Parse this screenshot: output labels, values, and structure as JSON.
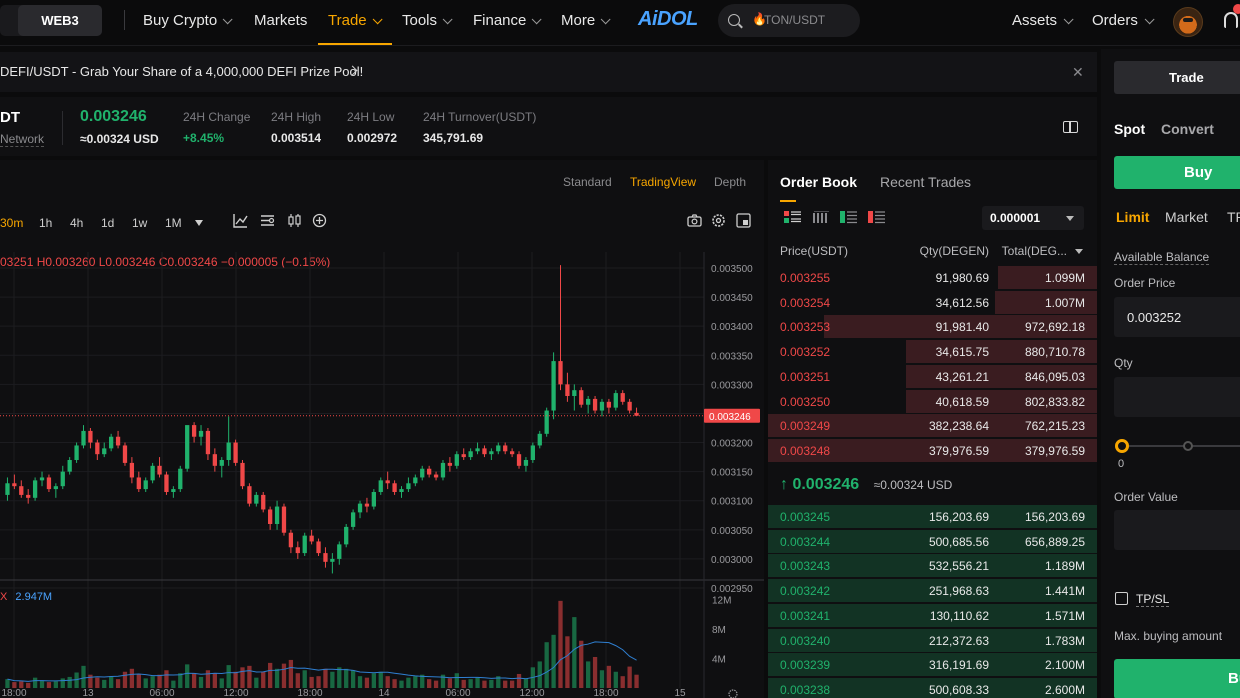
{
  "nav": {
    "segment_label": "WEB3",
    "items": [
      {
        "label": "Buy Crypto",
        "chevron": true
      },
      {
        "label": "Markets",
        "chevron": false
      },
      {
        "label": "Trade",
        "chevron": true,
        "active": true
      },
      {
        "label": "Tools",
        "chevron": true
      },
      {
        "label": "Finance",
        "chevron": true
      },
      {
        "label": "More",
        "chevron": true
      }
    ],
    "logo": "AiDOL",
    "search_placeholder": "TON/USDT",
    "assets_label": "Assets",
    "orders_label": "Orders"
  },
  "announcement": {
    "text": "DEFI/USDT - Grab Your Share of a 4,000,000 DEFI Prize Pool!"
  },
  "ticker": {
    "pair": "DT",
    "network_label": "Network",
    "last_price": "0.003246",
    "last_price_usd": "≈0.00324 USD",
    "stats": [
      {
        "label": "24H Change",
        "value": "+8.45%",
        "color": "#20b26c"
      },
      {
        "label": "24H High",
        "value": "0.003514",
        "color": "#e8e8e8"
      },
      {
        "label": "24H Low",
        "value": "0.002972",
        "color": "#e8e8e8"
      },
      {
        "label": "24H Turnover(USDT)",
        "value": "345,791.69",
        "color": "#e8e8e8"
      }
    ]
  },
  "chart": {
    "view_tabs": [
      "Standard",
      "TradingView",
      "Depth"
    ],
    "active_view": "TradingView",
    "intervals": [
      "30m",
      "1h",
      "4h",
      "1d",
      "1w",
      "1M"
    ],
    "active_interval": "30m",
    "ohlc_text": "03251  H0.003260  L0.003246  C0.003246  −0.000005 (−0.15%)",
    "volume_legend_prefix": "X",
    "volume_legend_value": "2.947M",
    "current_price_label": "0.003246"
  },
  "chart_data": {
    "type": "candlestick",
    "y_axis_ticks": [
      "0.003500",
      "0.003450",
      "0.003400",
      "0.003350",
      "0.003300",
      "0.003250",
      "0.003200",
      "0.003150",
      "0.003100",
      "0.003050",
      "0.003000",
      "0.002950"
    ],
    "ylim": [
      0.00295,
      0.0035
    ],
    "x_axis_ticks": [
      "18:00",
      "13",
      "06:00",
      "12:00",
      "18:00",
      "14",
      "06:00",
      "12:00",
      "18:00",
      "15"
    ],
    "volume_axis_ticks": [
      "12M",
      "8M",
      "4M"
    ],
    "candles": [
      [
        0.00311,
        0.00314,
        0.0031,
        0.00313
      ],
      [
        0.00313,
        0.003145,
        0.00312,
        0.003125
      ],
      [
        0.003125,
        0.003135,
        0.003105,
        0.00311
      ],
      [
        0.00311,
        0.00312,
        0.003095,
        0.003105
      ],
      [
        0.003105,
        0.00314,
        0.0031,
        0.003135
      ],
      [
        0.003135,
        0.00315,
        0.003125,
        0.00314
      ],
      [
        0.00314,
        0.003145,
        0.003115,
        0.00312
      ],
      [
        0.00312,
        0.00313,
        0.003105,
        0.003125
      ],
      [
        0.003125,
        0.00316,
        0.00312,
        0.00315
      ],
      [
        0.00315,
        0.003175,
        0.003145,
        0.00317
      ],
      [
        0.00317,
        0.0032,
        0.003165,
        0.003195
      ],
      [
        0.003195,
        0.00323,
        0.00319,
        0.00322
      ],
      [
        0.00322,
        0.003225,
        0.00319,
        0.0032
      ],
      [
        0.0032,
        0.003205,
        0.00317,
        0.00318
      ],
      [
        0.00318,
        0.0032,
        0.003175,
        0.00319
      ],
      [
        0.00319,
        0.003215,
        0.003185,
        0.00321
      ],
      [
        0.00321,
        0.00322,
        0.00319,
        0.003195
      ],
      [
        0.003195,
        0.0032,
        0.00316,
        0.003165
      ],
      [
        0.003165,
        0.003175,
        0.00313,
        0.00314
      ],
      [
        0.00314,
        0.00315,
        0.003115,
        0.00312
      ],
      [
        0.00312,
        0.00314,
        0.003115,
        0.003135
      ],
      [
        0.003135,
        0.003165,
        0.00313,
        0.00316
      ],
      [
        0.00316,
        0.003175,
        0.00314,
        0.003145
      ],
      [
        0.003145,
        0.00315,
        0.00311,
        0.003115
      ],
      [
        0.003115,
        0.003125,
        0.003105,
        0.00312
      ],
      [
        0.00312,
        0.00316,
        0.003115,
        0.003155
      ],
      [
        0.003155,
        0.003215,
        0.00315,
        0.00323
      ],
      [
        0.00323,
        0.003235,
        0.0032,
        0.00321
      ],
      [
        0.00321,
        0.00323,
        0.003195,
        0.00322
      ],
      [
        0.00322,
        0.003225,
        0.00317,
        0.00318
      ],
      [
        0.00318,
        0.00319,
        0.00315,
        0.00316
      ],
      [
        0.00316,
        0.003175,
        0.00314,
        0.00317
      ],
      [
        0.00317,
        0.003245,
        0.00316,
        0.0032
      ],
      [
        0.0032,
        0.003205,
        0.00316,
        0.003165
      ],
      [
        0.003165,
        0.00317,
        0.00312,
        0.003125
      ],
      [
        0.003125,
        0.00313,
        0.00309,
        0.003095
      ],
      [
        0.003095,
        0.003115,
        0.00309,
        0.00311
      ],
      [
        0.00311,
        0.003115,
        0.00308,
        0.003085
      ],
      [
        0.003085,
        0.00309,
        0.00305,
        0.00306
      ],
      [
        0.00306,
        0.0031,
        0.00305,
        0.00309
      ],
      [
        0.00309,
        0.003095,
        0.00304,
        0.003045
      ],
      [
        0.003045,
        0.00305,
        0.00301,
        0.00302
      ],
      [
        0.00302,
        0.00303,
        0.003,
        0.00301
      ],
      [
        0.00301,
        0.003045,
        0.003005,
        0.00304
      ],
      [
        0.00304,
        0.00305,
        0.003025,
        0.00303
      ],
      [
        0.00303,
        0.003035,
        0.003005,
        0.00301
      ],
      [
        0.00301,
        0.00302,
        0.002985,
        0.002995
      ],
      [
        0.002995,
        0.00301,
        0.002975,
        0.003
      ],
      [
        0.003,
        0.00303,
        0.00299,
        0.003025
      ],
      [
        0.003025,
        0.00306,
        0.00302,
        0.003055
      ],
      [
        0.003055,
        0.003085,
        0.00305,
        0.00308
      ],
      [
        0.00308,
        0.0031,
        0.00307,
        0.003095
      ],
      [
        0.003095,
        0.003105,
        0.00308,
        0.00309
      ],
      [
        0.00309,
        0.00312,
        0.003085,
        0.003115
      ],
      [
        0.003115,
        0.00314,
        0.00311,
        0.003135
      ],
      [
        0.003135,
        0.00315,
        0.00312,
        0.00313
      ],
      [
        0.00313,
        0.003135,
        0.00311,
        0.003115
      ],
      [
        0.003115,
        0.003125,
        0.003105,
        0.00312
      ],
      [
        0.00312,
        0.00314,
        0.003115,
        0.00313
      ],
      [
        0.00313,
        0.003145,
        0.003125,
        0.00314
      ],
      [
        0.00314,
        0.00316,
        0.003135,
        0.003155
      ],
      [
        0.003155,
        0.00316,
        0.00314,
        0.003145
      ],
      [
        0.003145,
        0.00315,
        0.003135,
        0.00314
      ],
      [
        0.00314,
        0.00317,
        0.003135,
        0.003165
      ],
      [
        0.003165,
        0.003175,
        0.00315,
        0.00316
      ],
      [
        0.00316,
        0.003185,
        0.003155,
        0.00318
      ],
      [
        0.00318,
        0.00319,
        0.00317,
        0.003175
      ],
      [
        0.003175,
        0.00319,
        0.00317,
        0.003185
      ],
      [
        0.003185,
        0.0032,
        0.00318,
        0.00319
      ],
      [
        0.00319,
        0.003195,
        0.003175,
        0.00318
      ],
      [
        0.00318,
        0.00319,
        0.00317,
        0.003185
      ],
      [
        0.003185,
        0.0032,
        0.00318,
        0.003195
      ],
      [
        0.003195,
        0.0032,
        0.00318,
        0.003185
      ],
      [
        0.003185,
        0.00319,
        0.003175,
        0.00318
      ],
      [
        0.00318,
        0.003185,
        0.003155,
        0.00316
      ],
      [
        0.00316,
        0.003175,
        0.00315,
        0.00317
      ],
      [
        0.00317,
        0.0032,
        0.003165,
        0.003195
      ],
      [
        0.003195,
        0.00322,
        0.00319,
        0.003215
      ],
      [
        0.003215,
        0.00326,
        0.00321,
        0.003255
      ],
      [
        0.003255,
        0.003355,
        0.00324,
        0.00334
      ],
      [
        0.00334,
        0.003505,
        0.00329,
        0.0033
      ],
      [
        0.0033,
        0.00332,
        0.00327,
        0.00328
      ],
      [
        0.00328,
        0.0033,
        0.003255,
        0.00329
      ],
      [
        0.00329,
        0.003295,
        0.00326,
        0.003265
      ],
      [
        0.003265,
        0.00328,
        0.00325,
        0.003275
      ],
      [
        0.003275,
        0.00328,
        0.00325,
        0.003255
      ],
      [
        0.003255,
        0.003275,
        0.003245,
        0.00327
      ],
      [
        0.00327,
        0.003275,
        0.00325,
        0.00326
      ],
      [
        0.00326,
        0.00329,
        0.003255,
        0.003285
      ],
      [
        0.003285,
        0.00329,
        0.003265,
        0.00327
      ],
      [
        0.00327,
        0.003275,
        0.00325,
        0.003255
      ],
      [
        0.003251,
        0.00326,
        0.003246,
        0.003246
      ]
    ],
    "volumes_m": [
      1.2,
      0.8,
      0.9,
      0.7,
      1.4,
      1.0,
      0.8,
      0.9,
      1.3,
      1.5,
      2.1,
      3.0,
      1.8,
      1.4,
      1.1,
      1.6,
      1.2,
      2.2,
      2.6,
      1.9,
      1.3,
      1.6,
      1.8,
      2.4,
      1.0,
      2.0,
      3.2,
      2.0,
      1.5,
      2.4,
      2.0,
      1.3,
      3.1,
      2.2,
      2.8,
      3.0,
      1.4,
      2.2,
      3.4,
      2.6,
      3.3,
      3.8,
      2.0,
      2.4,
      1.5,
      1.6,
      2.6,
      2.2,
      2.8,
      2.6,
      2.4,
      1.6,
      1.4,
      2.0,
      2.2,
      1.6,
      1.2,
      1.0,
      1.4,
      1.6,
      1.8,
      1.2,
      1.0,
      1.8,
      1.3,
      2.0,
      1.1,
      1.2,
      1.4,
      1.0,
      1.1,
      1.6,
      1.0,
      1.0,
      1.9,
      1.3,
      2.8,
      3.6,
      6.2,
      7.2,
      11.8,
      7.0,
      9.6,
      6.4,
      3.6,
      4.2,
      2.4,
      3.0,
      2.2,
      1.6,
      2.9,
      1.8
    ],
    "volume_ylim": [
      0,
      13
    ]
  },
  "orderbook": {
    "tabs": [
      "Order Book",
      "Recent Trades"
    ],
    "active_tab": "Order Book",
    "precision": "0.000001",
    "col_price": "Price(USDT)",
    "col_qty": "Qty(DEGEN)",
    "col_total": "Total(DEG...",
    "asks": [
      {
        "price": "0.003255",
        "qty": "91,980.69",
        "total": "1.099M",
        "depth": 0.3
      },
      {
        "price": "0.003254",
        "qty": "34,612.56",
        "total": "1.007M",
        "depth": 0.31
      },
      {
        "price": "0.003253",
        "qty": "91,981.40",
        "total": "972,692.18",
        "depth": 0.83
      },
      {
        "price": "0.003252",
        "qty": "34,615.75",
        "total": "880,710.78",
        "depth": 0.58
      },
      {
        "price": "0.003251",
        "qty": "43,261.21",
        "total": "846,095.03",
        "depth": 0.58
      },
      {
        "price": "0.003250",
        "qty": "40,618.59",
        "total": "802,833.82",
        "depth": 0.58
      },
      {
        "price": "0.003249",
        "qty": "382,238.64",
        "total": "762,215.23",
        "depth": 1.0
      },
      {
        "price": "0.003248",
        "qty": "379,976.59",
        "total": "379,976.59",
        "depth": 1.0
      }
    ],
    "mid_price": "0.003246",
    "mid_usd": "≈0.00324 USD",
    "bids": [
      {
        "price": "0.003245",
        "qty": "156,203.69",
        "total": "156,203.69",
        "depth": 1.0
      },
      {
        "price": "0.003244",
        "qty": "500,685.56",
        "total": "656,889.25",
        "depth": 1.0
      },
      {
        "price": "0.003243",
        "qty": "532,556.21",
        "total": "1.189M",
        "depth": 1.0
      },
      {
        "price": "0.003242",
        "qty": "251,968.63",
        "total": "1.441M",
        "depth": 1.0
      },
      {
        "price": "0.003241",
        "qty": "130,110.62",
        "total": "1.571M",
        "depth": 1.0
      },
      {
        "price": "0.003240",
        "qty": "212,372.63",
        "total": "1.783M",
        "depth": 1.0
      },
      {
        "price": "0.003239",
        "qty": "316,191.69",
        "total": "2.100M",
        "depth": 1.0
      },
      {
        "price": "0.003238",
        "qty": "500,608.33",
        "total": "2.600M",
        "depth": 1.0
      }
    ]
  },
  "trade": {
    "header_tab": "Trade",
    "mode_tabs": [
      "Spot",
      "Convert"
    ],
    "buy_label": "Buy",
    "order_types": [
      "Limit",
      "Market",
      "TP"
    ],
    "available_balance_label": "Available Balance",
    "order_price_label": "Order Price",
    "order_price_value": "0.003252",
    "qty_label": "Qty",
    "slider_min": "0",
    "order_value_label": "Order Value",
    "tpsl_label": "TP/SL",
    "max_buy_label": "Max. buying amount",
    "buy_bottom_label": "Buy"
  },
  "colors": {
    "up": "#20b26c",
    "down": "#f04848",
    "accent": "#f7a600"
  }
}
